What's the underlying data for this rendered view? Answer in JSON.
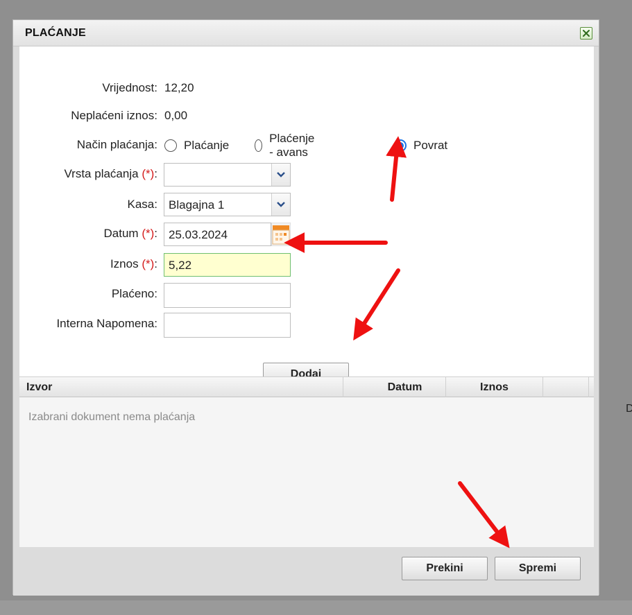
{
  "dialog": {
    "title": "PLAĆANJE",
    "close_icon": "close-x-icon"
  },
  "form": {
    "vrijednost": {
      "label": "Vrijednost:",
      "value": "12,20"
    },
    "neplaceni": {
      "label": "Neplaćeni iznos:",
      "value": "0,00"
    },
    "nacin": {
      "label": "Način plaćanja:",
      "options": [
        "Plaćanje",
        "Plaćenje - avans",
        "Povrat"
      ],
      "selected": "Povrat"
    },
    "vrsta": {
      "label": "Vrsta plaćanja",
      "req": "(*)",
      "colon": ":",
      "value": ""
    },
    "kasa": {
      "label": "Kasa:",
      "value": "Blagajna 1"
    },
    "datum": {
      "label": "Datum",
      "req": "(*)",
      "colon": ":",
      "value": "25.03.2024"
    },
    "iznos": {
      "label": "Iznos",
      "req": "(*)",
      "colon": ":",
      "value": "5,22"
    },
    "placeno": {
      "label": "Plaćeno:",
      "value": ""
    },
    "napomena": {
      "label": "Interna Napomena:",
      "value": ""
    },
    "add_button": "Dodaj"
  },
  "grid": {
    "columns": [
      "Izvor",
      "Datum",
      "Iznos"
    ],
    "empty_message": "Izabrani dokument nema plaćanja"
  },
  "footer": {
    "cancel_label": "Prekini",
    "save_label": "Spremi"
  },
  "background": {
    "text": "D"
  },
  "colors": {
    "overlay": "#8f8f8f",
    "required": "#d41b1b",
    "radio_selected": "#1a73e8",
    "highlight_field": "#ffffd0",
    "annotation_arrow": "#ee1111"
  }
}
